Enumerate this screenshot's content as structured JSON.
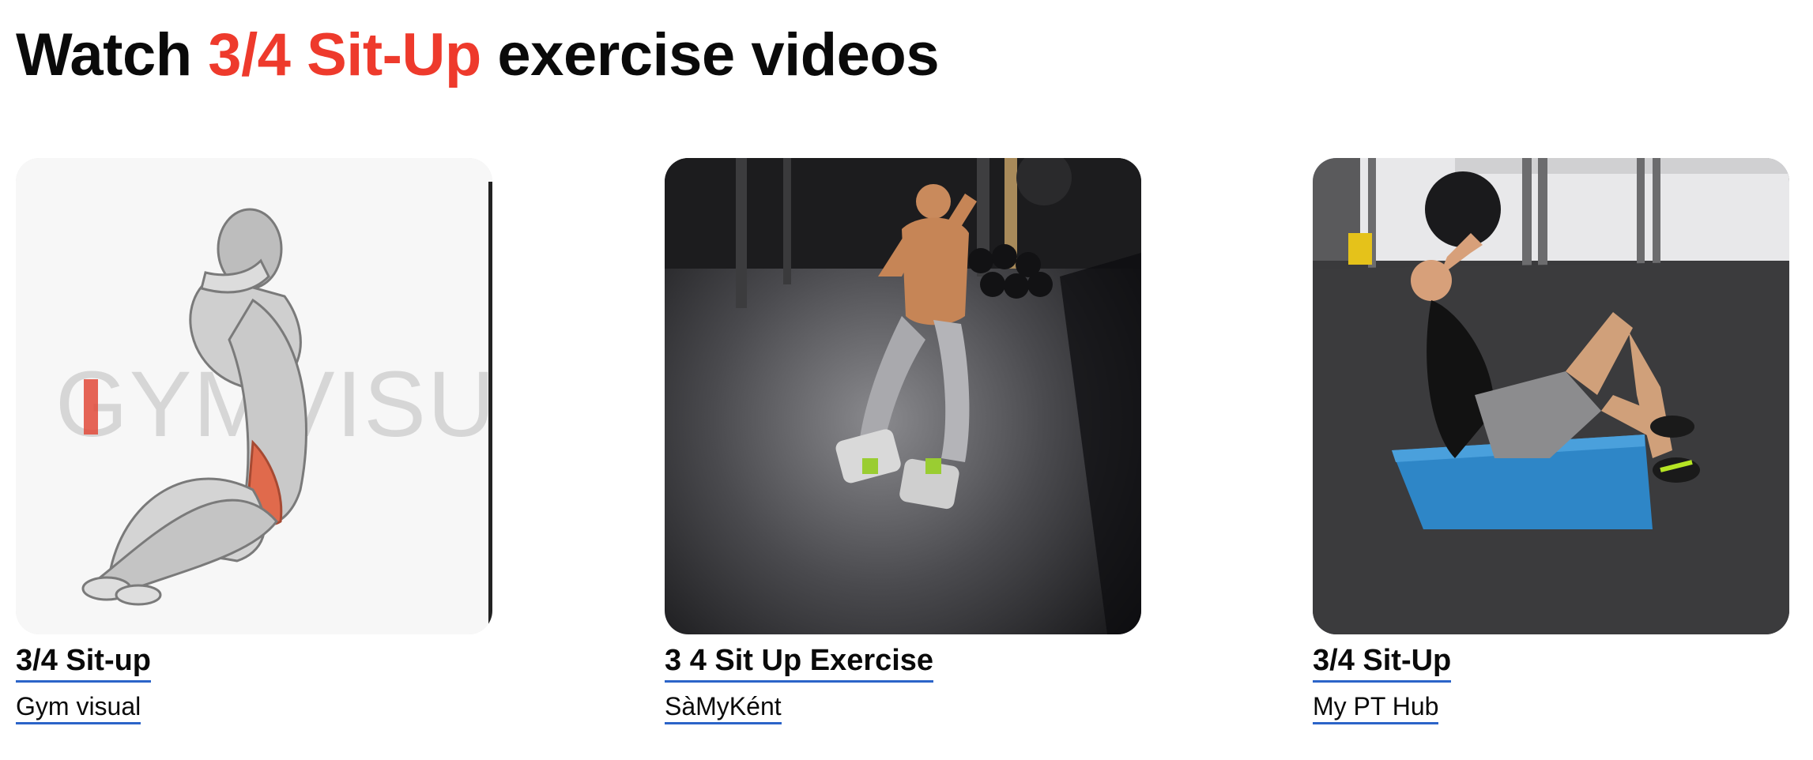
{
  "heading": {
    "prefix": "Watch ",
    "highlight": "3/4 Sit-Up",
    "suffix": " exercise videos",
    "highlight_color": "#ee3a2c"
  },
  "videos": [
    {
      "title": "3/4 Sit-up",
      "author": "Gym visual",
      "thumbnail": "illustrated-anatomy-situp",
      "watermark": "GYMVISUAL"
    },
    {
      "title": "3 4 Sit Up Exercise",
      "author": "SàMyKént",
      "thumbnail": "gym-floor-situp-photo"
    },
    {
      "title": "3/4 Sit-Up",
      "author": "My PT Hub",
      "thumbnail": "gym-mat-situp-photo"
    }
  ],
  "colors": {
    "link_underline": "#2c64c8",
    "text": "#0a0a0a",
    "background": "#ffffff"
  }
}
